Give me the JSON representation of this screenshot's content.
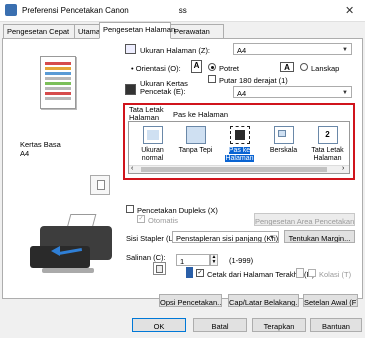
{
  "window": {
    "title": "Preferensi Pencetakan Canon",
    "title_suffix": "ss",
    "close": "✕"
  },
  "tabs": [
    {
      "label": "Pengesetan Cepat"
    },
    {
      "label": "Utama"
    },
    {
      "label": "Pengesetan Halaman"
    },
    {
      "label": "Perawatan"
    }
  ],
  "preview": {
    "media_label": "Kertas Basa",
    "size_label": "A4"
  },
  "page_size": {
    "label": "Ukuran Halaman (Z):",
    "value": "A4"
  },
  "orientation": {
    "label": "Orientasi (O):",
    "portrait": "Potret",
    "landscape": "Lanskap",
    "rotate": "Putar 180 derajat (1)"
  },
  "printer_paper": {
    "label": "Ukuran Kertas Pencetak (E):",
    "value": "A4"
  },
  "layout": {
    "label": "Tata Letak Halaman (Y):",
    "current": "Pas ke Halaman",
    "options": [
      {
        "label": "Ukuran normal"
      },
      {
        "label": "Tanpa Tepi"
      },
      {
        "label": "Pas ke Halaman"
      },
      {
        "label": "Berskala"
      },
      {
        "label": "Tata Letak Halaman"
      }
    ]
  },
  "duplex": {
    "label": "Pencetakan Dupleks (X)",
    "automatic": "Otomatis",
    "area_button": "Pengesetan Area Pencetakan..."
  },
  "stapling": {
    "label": "Sisi Stapler (L):",
    "value": "Penstapleran sisi panjang (Kri)",
    "margin_button": "Tentukan Margin..."
  },
  "copies": {
    "label": "Salinan (C):",
    "value": "1",
    "range": "(1-999)",
    "reverse": "Cetak dari Halaman Terakhir (R)",
    "collate": "Kolasi (T)"
  },
  "panel_buttons": {
    "print_options": "Opsi Pencetakan...",
    "stamp": "Cap/Latar Belakang...",
    "defaults": "Setelan Awal (F)"
  },
  "dialog_buttons": {
    "ok": "OK",
    "cancel": "Batal",
    "apply": "Terapkan",
    "help": "Bantuan"
  }
}
